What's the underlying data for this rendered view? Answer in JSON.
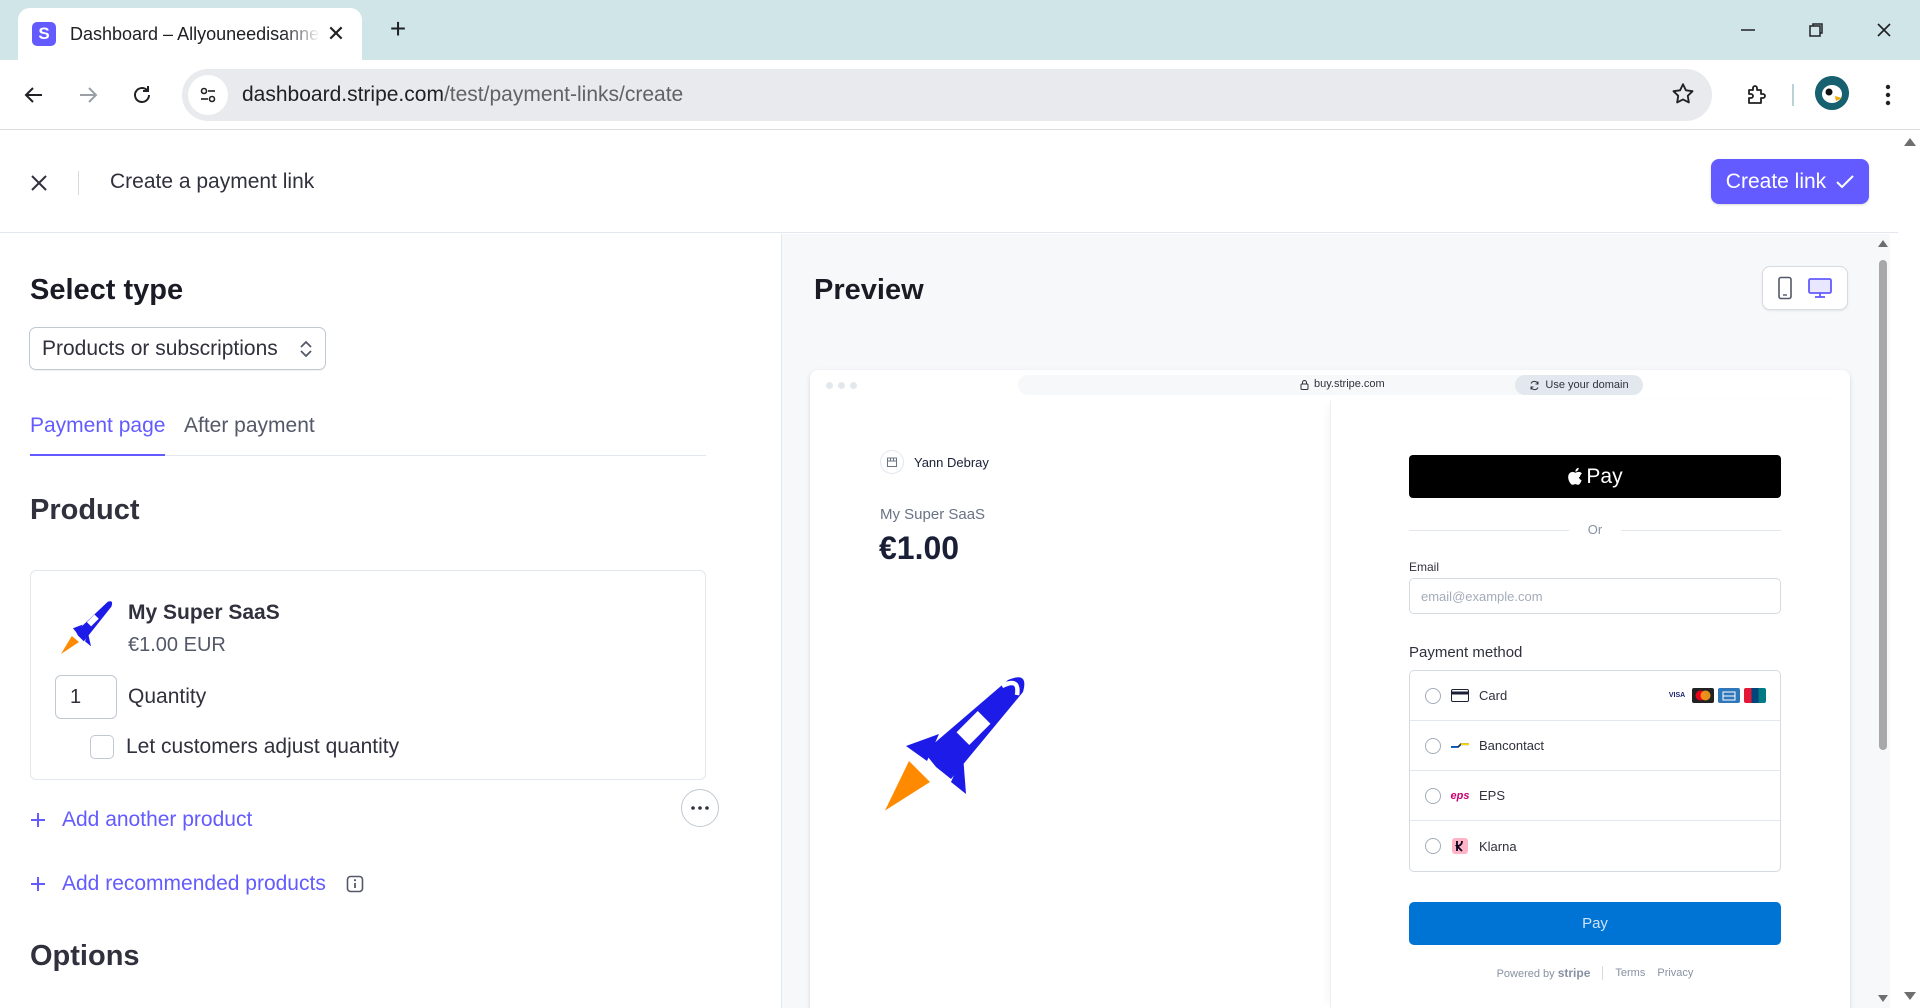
{
  "browser": {
    "tab_title": "Dashboard – Allyouneedisanne",
    "tab_favicon_letter": "S",
    "url_host": "dashboard.stripe.com",
    "url_path": "/test/payment-links/create"
  },
  "header": {
    "title": "Create a payment link",
    "create_button": "Create link"
  },
  "form": {
    "select_type_heading": "Select type",
    "type_value": "Products or subscriptions",
    "tabs": [
      {
        "label": "Payment page",
        "active": true
      },
      {
        "label": "After payment",
        "active": false
      }
    ],
    "product_heading": "Product",
    "product": {
      "name": "My Super SaaS",
      "price": "€1.00 EUR",
      "quantity": "1",
      "quantity_label": "Quantity",
      "adjust_label": "Let customers adjust quantity"
    },
    "add_another_product": "Add another product",
    "add_recommended_products": "Add recommended products",
    "options_heading": "Options"
  },
  "preview": {
    "heading": "Preview",
    "frame_url": "buy.stripe.com",
    "domain_button": "Use your domain",
    "merchant_name": "Yann Debray",
    "product_name": "My Super SaaS",
    "price": "€1.00",
    "apple_pay_label": "Pay",
    "or_label": "Or",
    "email_label": "Email",
    "email_placeholder": "email@example.com",
    "payment_method_label": "Payment method",
    "methods": [
      {
        "label": "Card",
        "icon": "card-icon"
      },
      {
        "label": "Bancontact",
        "icon": "bancontact-icon"
      },
      {
        "label": "EPS",
        "icon": "eps-icon"
      },
      {
        "label": "Klarna",
        "icon": "klarna-icon"
      }
    ],
    "card_brands": [
      "VISA",
      "MC",
      "AMEX",
      "UP"
    ],
    "pay_button": "Pay",
    "footer_powered": "Powered by",
    "footer_brand": "stripe",
    "footer_terms": "Terms",
    "footer_privacy": "Privacy"
  },
  "colors": {
    "accent": "#635bff",
    "pay_blue": "#0074d4",
    "rocket_blue": "#1d1be8",
    "rocket_flame": "#ff8a00"
  }
}
